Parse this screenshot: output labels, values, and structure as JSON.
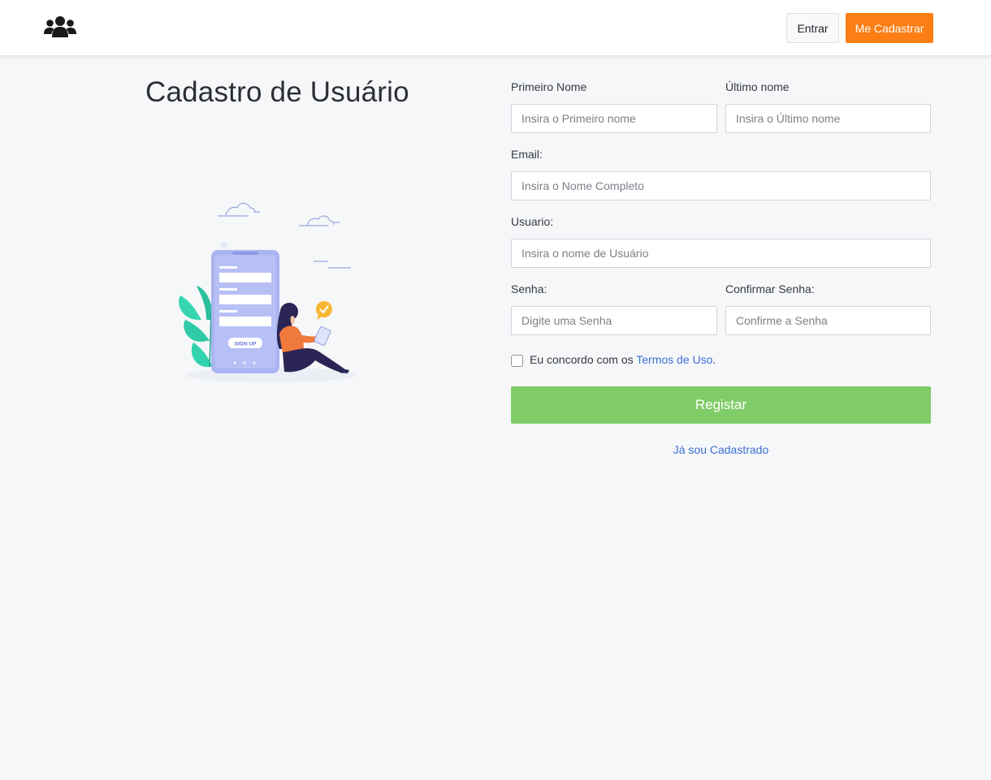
{
  "header": {
    "logo_icon": "users-icon",
    "login_label": "Entrar",
    "signup_label": "Me Cadastrar",
    "signup_color": "#fd7e14"
  },
  "page": {
    "title": "Cadastro de Usuário",
    "illustration_button_text": "SIGN UP"
  },
  "form": {
    "first_name": {
      "label": "Primeiro Nome",
      "placeholder": "Insira o Primeiro nome",
      "value": ""
    },
    "last_name": {
      "label": "Último nome",
      "placeholder": "Insira o Último nome",
      "value": ""
    },
    "email": {
      "label": "Email:",
      "placeholder": "Insira o Nome Completo",
      "value": ""
    },
    "username": {
      "label": "Usuario:",
      "placeholder": "Insira o nome de Usuário",
      "value": ""
    },
    "password": {
      "label": "Senha:",
      "placeholder": "Digite uma Senha",
      "value": ""
    },
    "confirm_password": {
      "label": "Confirmar Senha:",
      "placeholder": "Confirme a Senha",
      "value": ""
    },
    "terms": {
      "prefix": "Eu concordo com os ",
      "link": "Termos de Uso",
      "suffix": ".",
      "checked": false
    },
    "submit_label": "Registar",
    "submit_color": "#80cc68",
    "already_registered": "Já sou Cadastrado"
  }
}
